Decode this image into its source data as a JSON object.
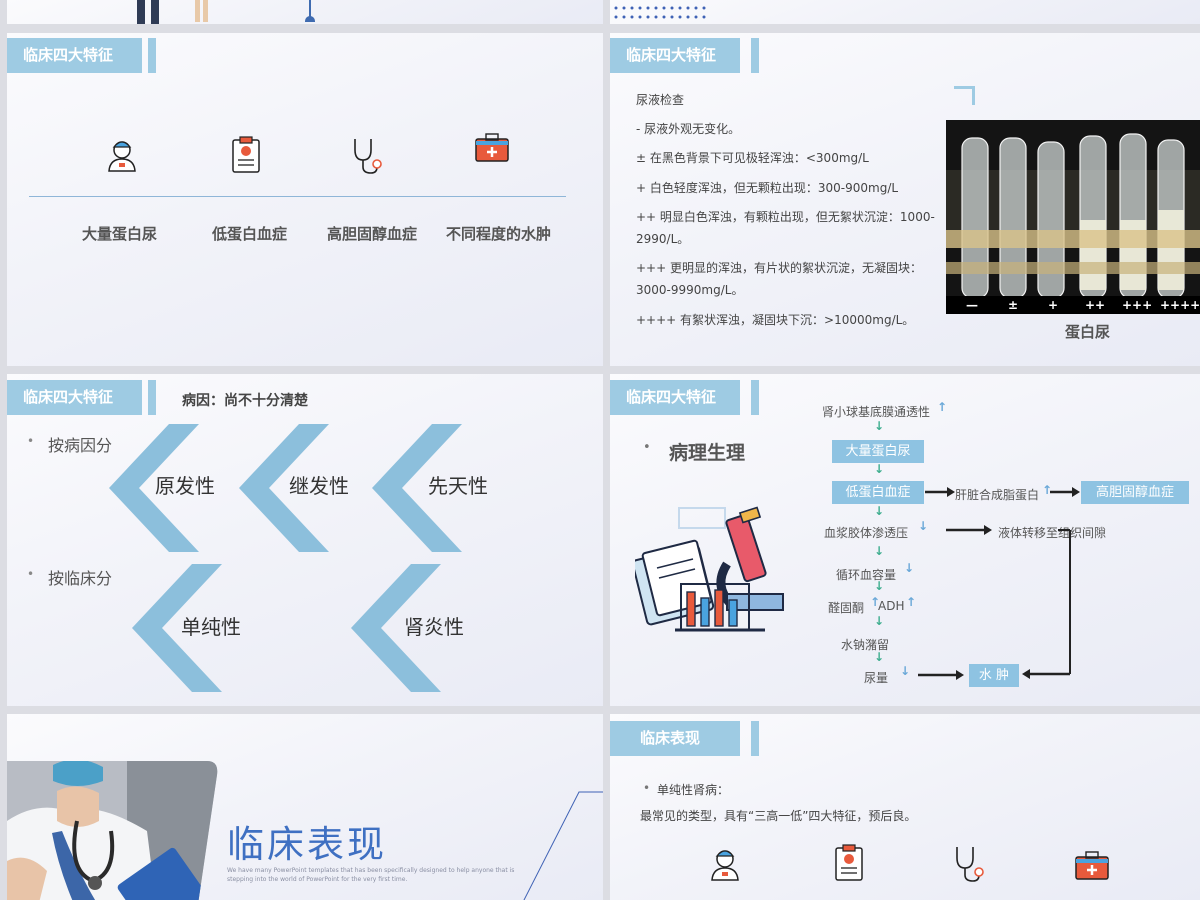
{
  "s1": {
    "tag": "临床四大特征",
    "labels": [
      "大量蛋白尿",
      "低蛋白血症",
      "高胆固醇血症",
      "不同程度的水肿"
    ]
  },
  "s2": {
    "tag": "临床四大特征",
    "lines": [
      "尿液检查",
      "-  尿液外观无变化。",
      "± 在黑色背景下可见极轻浑浊：<300mg/L",
      "+ 白色轻度浑浊，但无颗粒出现：300-900mg/L",
      "++ 明显白色浑浊，有颗粒出现，但无絮状沉淀：1000-",
      "2990/L。",
      "+++ 更明显的浑浊，有片状的絮状沉淀，无凝固块：",
      "3000-9990mg/L。",
      "++++ 有絮状浑浊，凝固块下沉：>10000mg/L。"
    ],
    "tube_marks": [
      "—",
      "±",
      "+",
      "++",
      "+++",
      "++++"
    ],
    "caption": "蛋白尿"
  },
  "s3": {
    "tag": "临床四大特征",
    "cause": "病因：尚不十分清楚",
    "group1": "按病因分",
    "group2": "按临床分",
    "types1": [
      "原发性",
      "继发性",
      "先天性"
    ],
    "types2": [
      "单纯性",
      "肾炎性"
    ]
  },
  "s4": {
    "tag": "临床四大特征",
    "heading": "病理生理",
    "flow": {
      "top": "肾小球基底膜通透性",
      "box1": "大量蛋白尿",
      "box2": "低蛋白血症",
      "liver": "肝脏合成脂蛋白",
      "box3": "高胆固醇血症",
      "plasma": "血浆胶体渗透压",
      "fluid": "液体转移至组织间隙",
      "volume": "循环血容量",
      "aldo": "醛固酮",
      "adh": "ADH",
      "retain": "水钠潴留",
      "urine": "尿量",
      "edema": "水 肿"
    }
  },
  "s5": {
    "title": "临床表现",
    "sub": "We have many PowerPoint templates that has been specifically designed to help anyone that is stepping into the world of PowerPoint for the very first time."
  },
  "s6": {
    "tag": "临床表现",
    "bullet": "单纯性肾病：",
    "desc": "最常见的类型，具有“三高一低”四大特征，预后良。"
  },
  "colors": {
    "accent": "#9ecbe3",
    "flow": "#8ec3e2",
    "chevron": "#8cbfdc",
    "dark": "#222222"
  }
}
